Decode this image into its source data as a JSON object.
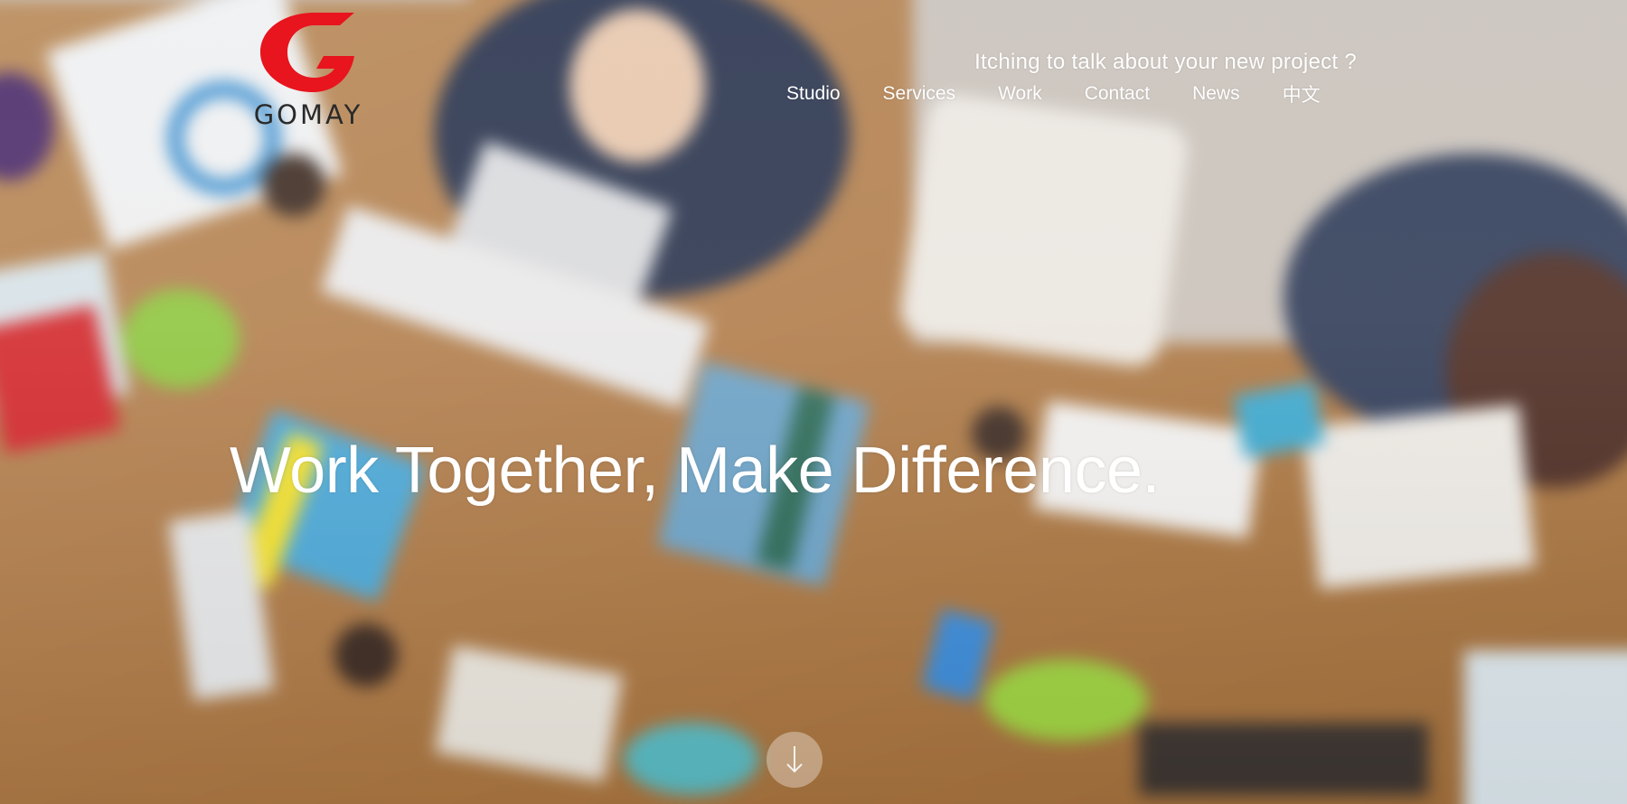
{
  "brand": {
    "name": "GOMAY",
    "accent_color": "#e8141e"
  },
  "header": {
    "tagline": "Itching to talk about your new project ?",
    "nav": [
      {
        "label": "Studio"
      },
      {
        "label": "Services"
      },
      {
        "label": "Work"
      },
      {
        "label": "Contact"
      },
      {
        "label": "News"
      },
      {
        "label": "中文"
      }
    ]
  },
  "hero": {
    "headline": "Work Together, Make Difference.",
    "scroll_icon": "arrow-down-icon"
  }
}
